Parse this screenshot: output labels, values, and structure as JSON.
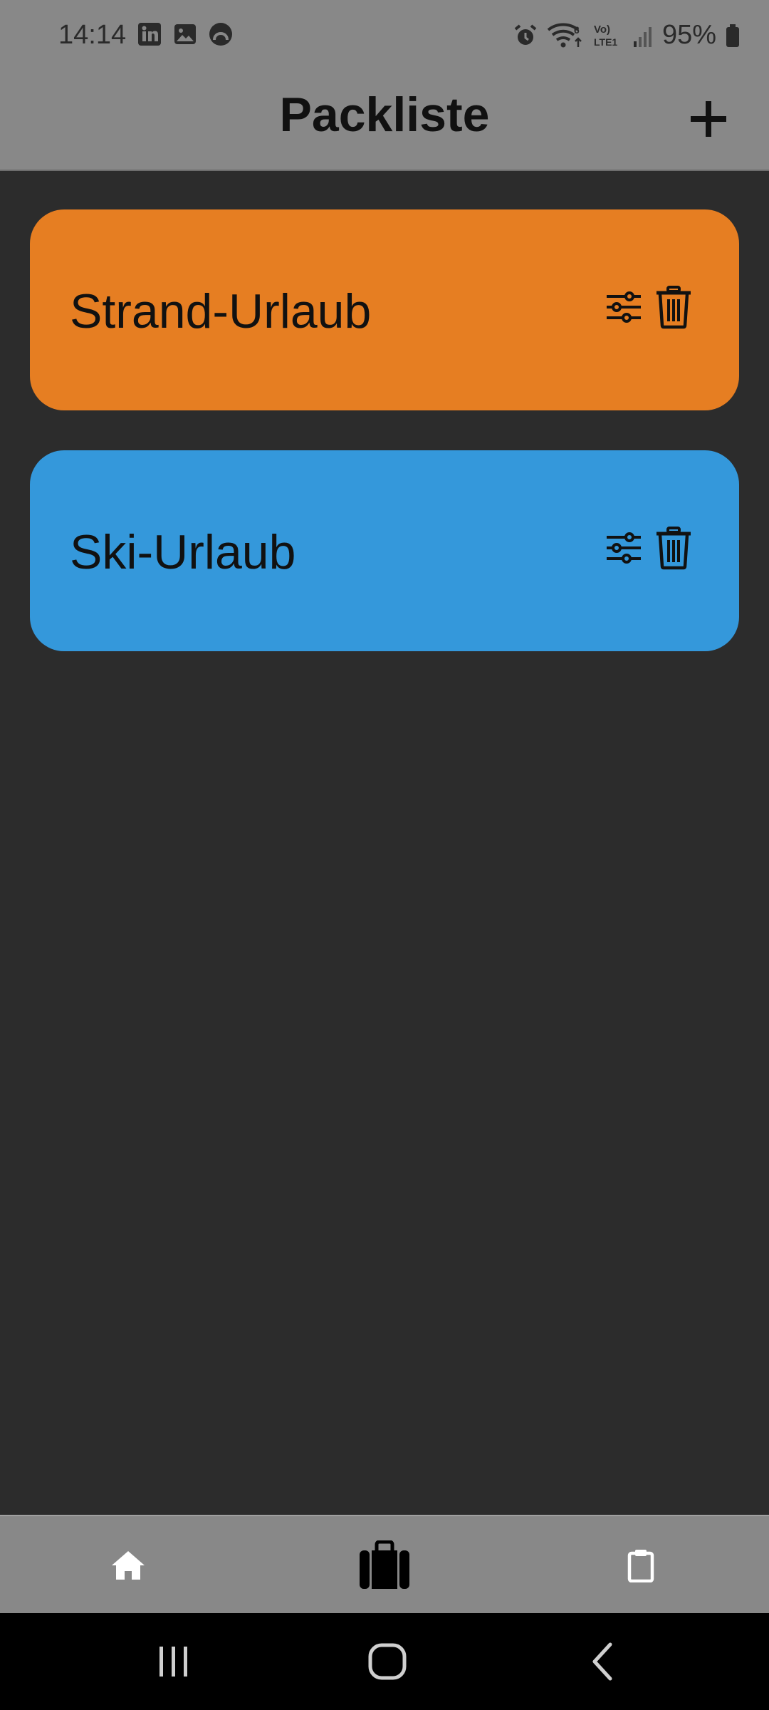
{
  "status_bar": {
    "time": "14:14",
    "battery_percent": "95%",
    "left_icons": [
      "linkedin-icon",
      "gallery-icon",
      "app-notification-icon"
    ],
    "right_icons": [
      "alarm-icon",
      "wifi-6-icon",
      "volte-lte1-icon",
      "signal-icon",
      "battery-icon"
    ],
    "volte_top": "Vo)",
    "volte_bottom": "LTE1",
    "wifi_badge": "6"
  },
  "app_bar": {
    "title": "Packliste",
    "add_icon": "plus-icon"
  },
  "lists": [
    {
      "name": "Strand-Urlaub",
      "color": "#e67e22",
      "icons": [
        "sliders-icon",
        "trash-icon"
      ]
    },
    {
      "name": "Ski-Urlaub",
      "color": "#3498db",
      "icons": [
        "sliders-icon",
        "trash-icon"
      ]
    }
  ],
  "colors": {
    "background": "#2c2c2c",
    "bars": "#888888",
    "system_nav": "#000000"
  },
  "bottom_nav": {
    "items": [
      {
        "icon": "home-icon",
        "active": false
      },
      {
        "icon": "suitcase-icon",
        "active": true
      },
      {
        "icon": "clipboard-icon",
        "active": false
      }
    ]
  },
  "system_nav": [
    "recent-apps-icon",
    "home-button-icon",
    "back-icon"
  ]
}
